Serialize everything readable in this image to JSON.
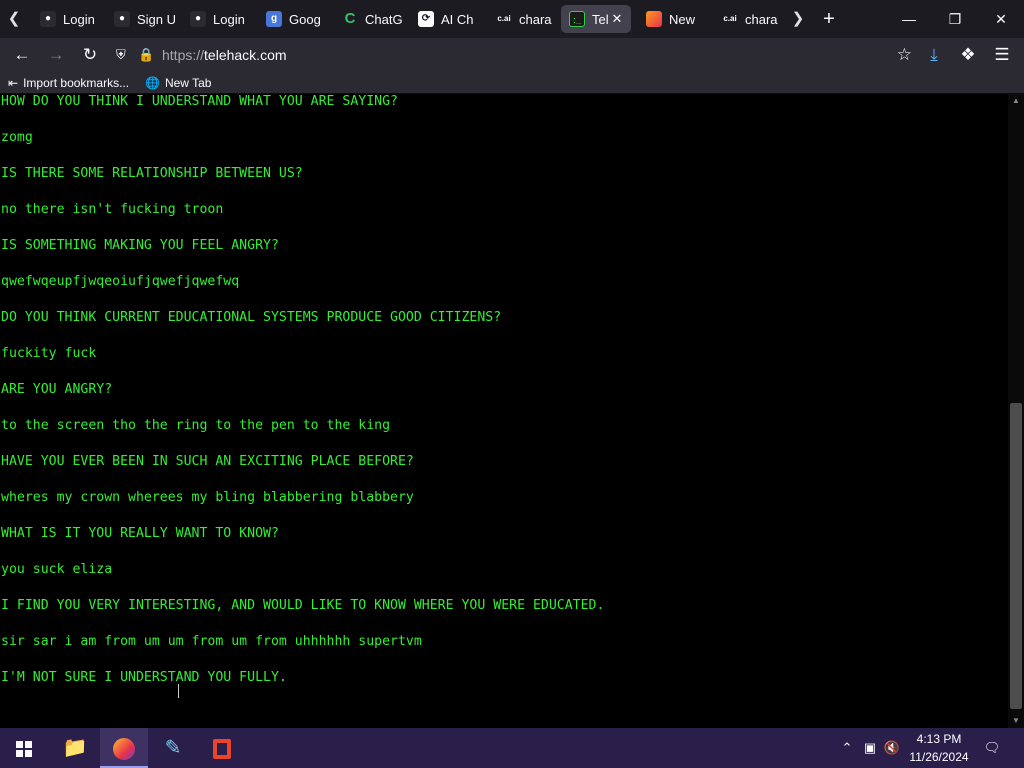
{
  "browser": {
    "tabs": [
      {
        "label": "Login",
        "favicon": "github-icon",
        "active": false
      },
      {
        "label": "Sign U",
        "favicon": "github-icon",
        "active": false
      },
      {
        "label": "Login",
        "favicon": "github-icon",
        "active": false
      },
      {
        "label": "Goog",
        "favicon": "google-translate-icon",
        "active": false
      },
      {
        "label": "ChatG",
        "favicon": "chat-icon",
        "active": false
      },
      {
        "label": "AI Ch",
        "favicon": "ai-chat-icon",
        "active": false
      },
      {
        "label": "chara",
        "favicon": "character-ai-icon",
        "active": false
      },
      {
        "label": "Tel",
        "favicon": "terminal-icon",
        "active": true
      },
      {
        "label": "New",
        "favicon": "firefox-icon",
        "active": false
      },
      {
        "label": "chara",
        "favicon": "character-ai-icon",
        "active": false
      }
    ],
    "url_protocol": "https://",
    "url_host": "telehack.com",
    "bookmarks": [
      {
        "label": "Import bookmarks...",
        "icon": "import-icon"
      },
      {
        "label": "New Tab",
        "icon": "globe-icon"
      }
    ]
  },
  "terminal": {
    "text_color": "#33ee33",
    "background": "#000000",
    "lines": [
      "HOW DO YOU THINK I UNDERSTAND WHAT YOU ARE SAYING?",
      "zomg",
      "IS THERE SOME RELATIONSHIP BETWEEN US?",
      "no there isn't fucking troon",
      "IS SOMETHING MAKING YOU FEEL ANGRY?",
      "qwefwqeupfjwqeoiufjqwefjqwefwq",
      "DO YOU THINK CURRENT EDUCATIONAL SYSTEMS PRODUCE GOOD CITIZENS?",
      "fuckity fuck",
      "ARE YOU ANGRY?",
      "to the screen tho the ring to the pen to the king",
      "HAVE YOU EVER BEEN IN SUCH AN EXCITING PLACE BEFORE?",
      "wheres my crown wherees my bling blabbering blabbery",
      "WHAT IS IT YOU REALLY WANT TO KNOW?",
      "you suck eliza",
      "I FIND YOU VERY INTERESTING, AND WOULD LIKE TO KNOW WHERE YOU WERE EDUCATED.",
      "sir sar i am from um um from um from uhhhhhh supertvm",
      "I'M NOT SURE I UNDERSTAND YOU FULLY."
    ]
  },
  "taskbar": {
    "clock_time": "4:13 PM",
    "clock_date": "11/26/2024"
  }
}
